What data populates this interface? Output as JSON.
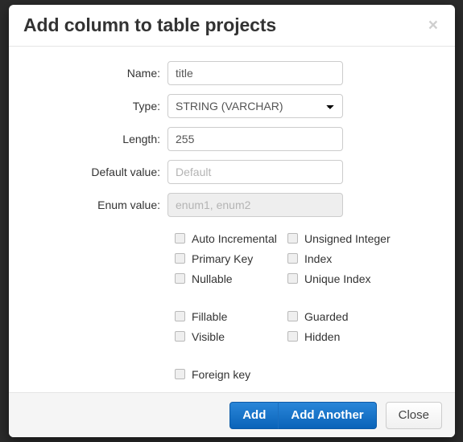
{
  "modal": {
    "title": "Add column to table projects",
    "close_icon": "close-icon",
    "close_label": "×"
  },
  "form": {
    "fields": [
      {
        "label": "Name:",
        "value": "title",
        "placeholder": "",
        "type": "text",
        "disabled": false
      },
      {
        "label": "Type:",
        "value": "STRING (VARCHAR)",
        "placeholder": "",
        "type": "select",
        "disabled": false
      },
      {
        "label": "Length:",
        "value": "255",
        "placeholder": "",
        "type": "text",
        "disabled": false
      },
      {
        "label": "Default value:",
        "value": "",
        "placeholder": "Default",
        "type": "text",
        "disabled": false
      },
      {
        "label": "Enum value:",
        "value": "",
        "placeholder": "enum1, enum2",
        "type": "text",
        "disabled": true
      }
    ],
    "checkbox_groups": [
      {
        "rows": [
          {
            "left": "Auto Incremental",
            "right": "Unsigned Integer"
          },
          {
            "left": "Primary Key",
            "right": "Index"
          },
          {
            "left": "Nullable",
            "right": "Unique Index"
          }
        ]
      },
      {
        "rows": [
          {
            "left": "Fillable",
            "right": "Guarded"
          },
          {
            "left": "Visible",
            "right": "Hidden"
          }
        ]
      },
      {
        "rows": [
          {
            "left": "Foreign key",
            "right": ""
          }
        ]
      }
    ]
  },
  "footer": {
    "add_label": "Add",
    "add_another_label": "Add Another",
    "close_label": "Close"
  },
  "colors": {
    "primary": "#0a63b9",
    "backdrop": "#2b2b2b",
    "footer_bg": "#f5f5f5",
    "border": "#cccccc"
  }
}
